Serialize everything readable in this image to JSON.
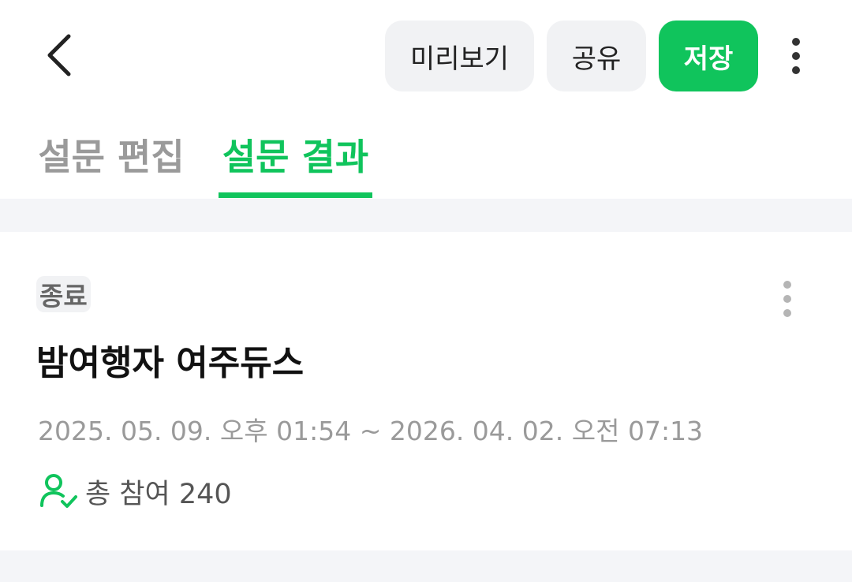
{
  "header": {
    "back_icon": "chevron-left-icon",
    "buttons": {
      "preview": "미리보기",
      "share": "공유",
      "save": "저장"
    },
    "more_icon": "more-vertical-icon"
  },
  "tabs": [
    {
      "label": "설문 편집",
      "active": false
    },
    {
      "label": "설문 결과",
      "active": true
    }
  ],
  "colors": {
    "accent": "#10c45c",
    "inactive_tab": "#9a9a9a",
    "pill_bg": "#f1f2f4",
    "band_bg": "#f4f5f8"
  },
  "survey": {
    "status": "종료",
    "title": "밤여행자 여주듀스",
    "date_range": "2025. 05. 09. 오후 01:54 ~ 2026. 04. 02. 오전 07:13",
    "participants_label": "총 참여 240",
    "participants_icon": "user-check-icon"
  }
}
